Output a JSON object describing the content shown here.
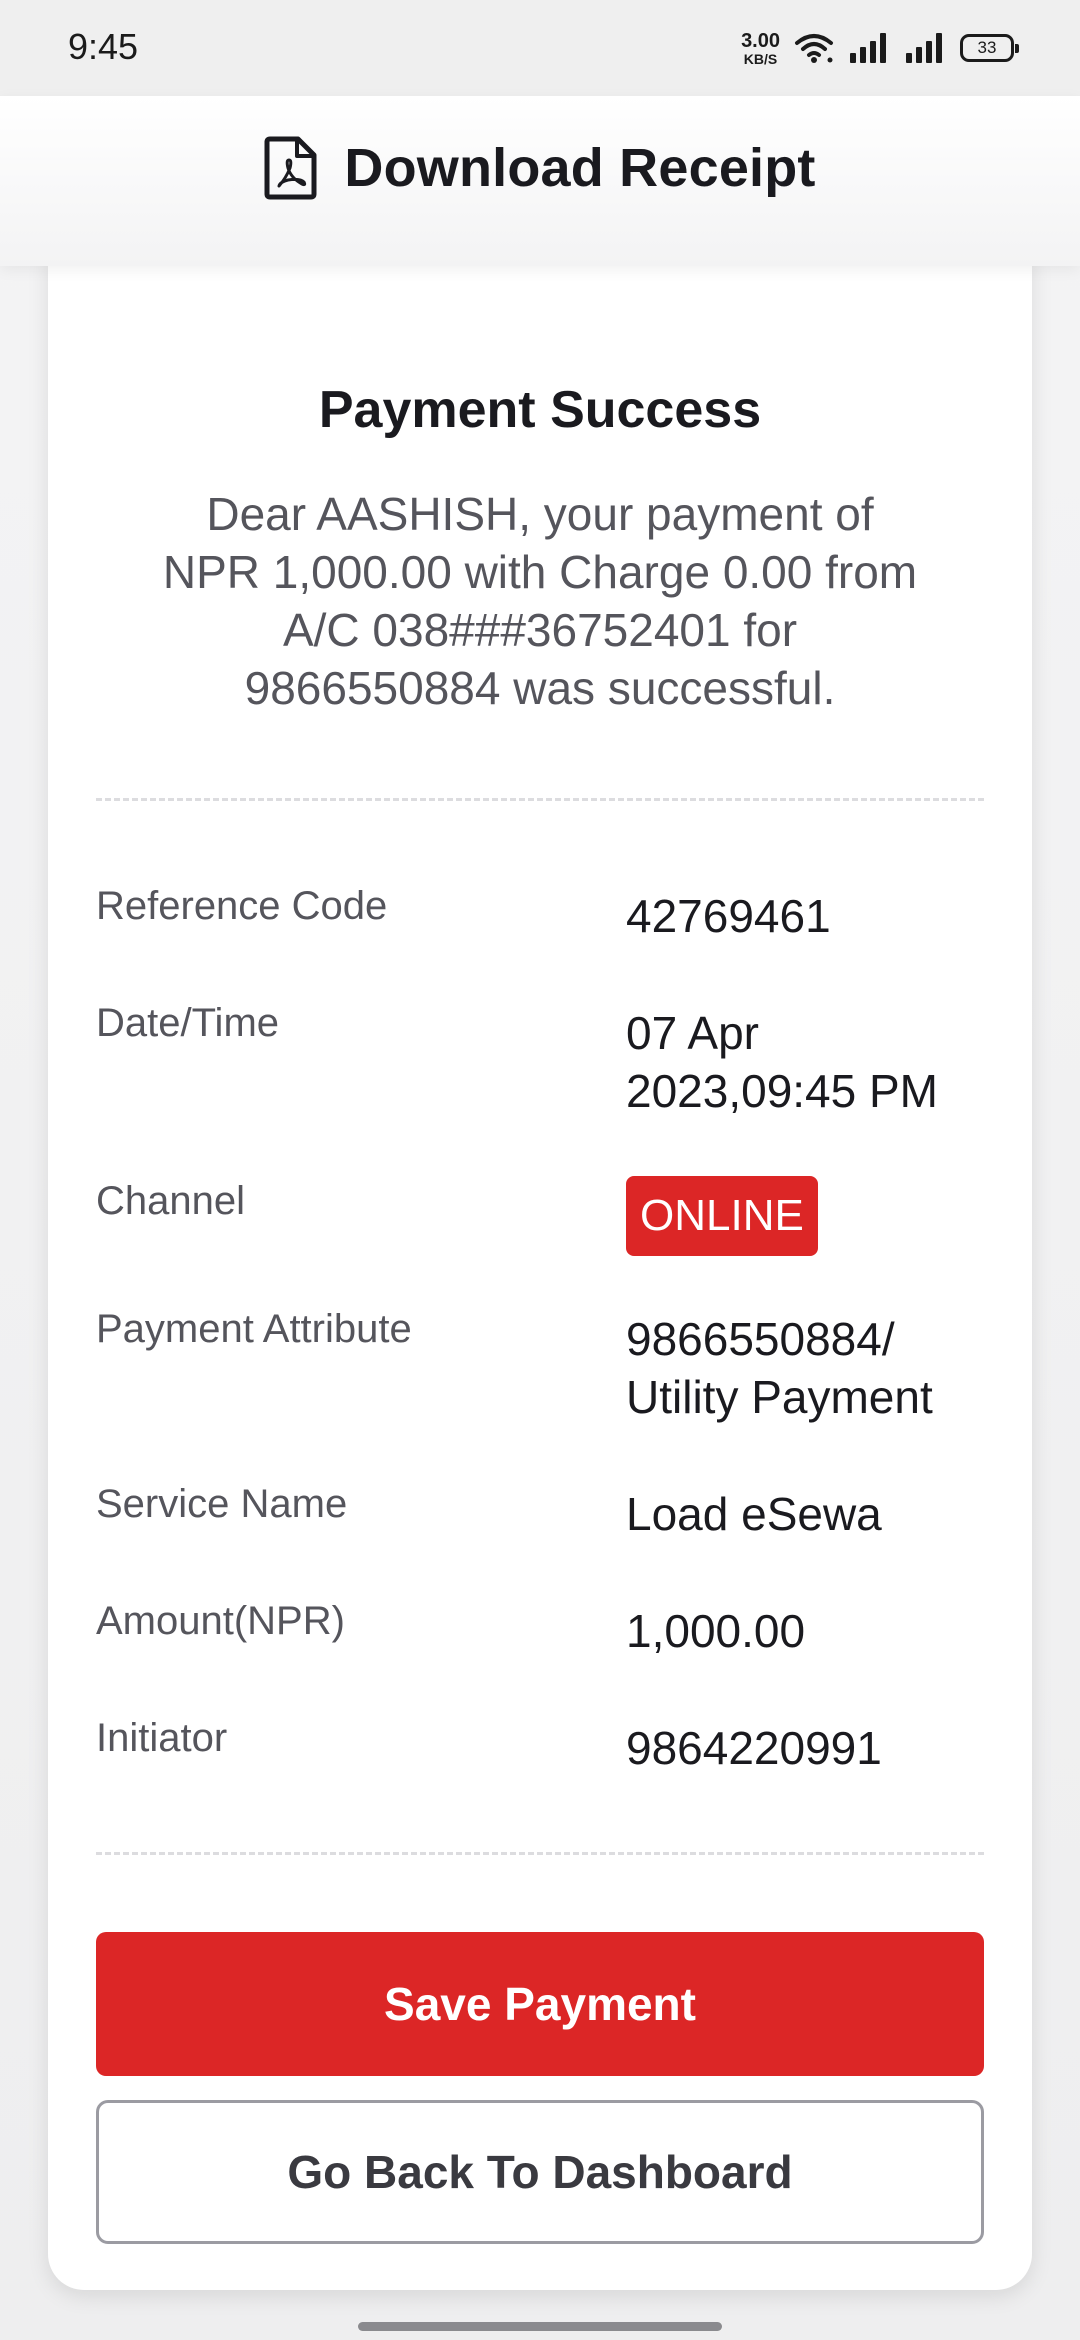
{
  "status_bar": {
    "time": "9:45",
    "net_speed_value": "3.00",
    "net_speed_unit": "KB/S",
    "battery_level": "33"
  },
  "header": {
    "title": "Download Receipt",
    "icon": "pdf-file-icon"
  },
  "card": {
    "title": "Payment Success",
    "message": "Dear AASHISH, your payment of NPR 1,000.00 with Charge 0.00 from A/C 038###36752401 for 9866550884 was successful."
  },
  "details": {
    "reference_code": {
      "label": "Reference Code",
      "value": "42769461"
    },
    "date_time": {
      "label": "Date/Time",
      "value_line1": "07 Apr",
      "value_line2": "2023,09:45 PM"
    },
    "channel": {
      "label": "Channel",
      "value": "ONLINE"
    },
    "payment_attribute": {
      "label": "Payment Attribute",
      "value_line1": "9866550884/",
      "value_line2": "Utility Payment"
    },
    "service_name": {
      "label": "Service Name",
      "value": "Load eSewa"
    },
    "amount": {
      "label": "Amount(NPR)",
      "value": "1,000.00"
    },
    "initiator": {
      "label": "Initiator",
      "value": "9864220991"
    }
  },
  "actions": {
    "save_label": "Save Payment",
    "back_label": "Go Back To Dashboard"
  },
  "colors": {
    "accent": "#dc2626",
    "text_primary": "#1a1a1f",
    "text_secondary": "#55555c"
  }
}
